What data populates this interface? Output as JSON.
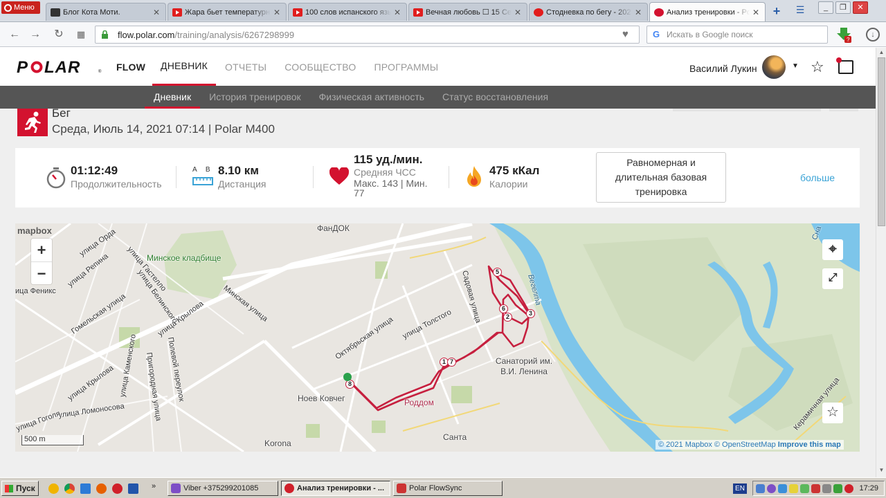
{
  "browser": {
    "menu_label": "Меню",
    "tabs": [
      {
        "title": "Блог Кота Моти.",
        "favicon": "cat-icon"
      },
      {
        "title": "Жара бьет температурн",
        "favicon": "youtube-icon"
      },
      {
        "title": "100 слов испанского язы",
        "favicon": "youtube-icon"
      },
      {
        "title": "Вечная любовь ☐ 15 Се",
        "favicon": "youtube-icon"
      },
      {
        "title": "Стодневка по бегу - 202",
        "favicon": "stop-icon"
      },
      {
        "title": "Анализ тренировки - Po",
        "favicon": "polar-icon"
      }
    ],
    "url_host": "flow.polar.com",
    "url_path": "/training/analysis/6267298999",
    "search_placeholder": "Искать в Google поиск"
  },
  "header": {
    "logo": "POLAR",
    "nav": [
      {
        "label": "FLOW"
      },
      {
        "label": "ДНЕВНИК"
      },
      {
        "label": "ОТЧЕТЫ"
      },
      {
        "label": "СООБЩЕСТВО"
      },
      {
        "label": "ПРОГРАММЫ"
      }
    ],
    "user_name": "Василий Лукин"
  },
  "subnav": [
    {
      "label": "Дневник"
    },
    {
      "label": "История тренировок"
    },
    {
      "label": "Физическая активность"
    },
    {
      "label": "Статус восстановления"
    }
  ],
  "session": {
    "sport": "Бег",
    "subtitle": "Среда, Июль 14, 2021 07:14 | Polar M400"
  },
  "summary": {
    "duration_value": "01:12:49",
    "duration_label": "Продолжительность",
    "distance_ab": "A B",
    "distance_value": "8.10 км",
    "distance_label": "Дистанция",
    "hr_value": "115 уд./мин.",
    "hr_label": "Средняя ЧСС",
    "hr_range": "Макс. 143 | Мин. 77",
    "calories_value": "475 кКал",
    "calories_label": "Калории",
    "training_benefit": "Равномерная и длительная базовая тренировка",
    "more_label": "больше"
  },
  "map": {
    "provider_logo": "mapbox",
    "scale_label": "500 m",
    "attribution_1": "© 2021 Mapbox",
    "attribution_2": "© OpenStreetMap",
    "attribution_3": "Improve this map",
    "zoom_in": "+",
    "zoom_out": "−",
    "labels": [
      {
        "text": "Минское кладбище",
        "kind": "green"
      },
      {
        "text": "ФанДОК",
        "kind": "big"
      },
      {
        "text": "улица Орда"
      },
      {
        "text": "улица Репина"
      },
      {
        "text": "улица Гастелло"
      },
      {
        "text": "улица Белинского"
      },
      {
        "text": "Минская улица"
      },
      {
        "text": "Гомельская улица"
      },
      {
        "text": "улица Крылова"
      },
      {
        "text": "улица Крылова"
      },
      {
        "text": "Полевой переулок"
      },
      {
        "text": "Пригородная улица"
      },
      {
        "text": "улица Каменского"
      },
      {
        "text": "улица Ломоносова"
      },
      {
        "text": "улица Гоголя"
      },
      {
        "text": "Октябрьская улица"
      },
      {
        "text": "улица Толстого"
      },
      {
        "text": "Садовая улица"
      },
      {
        "text": "Санаторий им. В.И. Ленина",
        "kind": "big"
      },
      {
        "text": "Ноев Ковчег",
        "kind": "big"
      },
      {
        "text": "Роддом",
        "kind": "red"
      },
      {
        "text": "Korona",
        "kind": "big"
      },
      {
        "text": "Санта",
        "kind": "big"
      },
      {
        "text": "Керамичная улица"
      },
      {
        "text": "Вегелта",
        "kind": "water"
      },
      {
        "text": "Сна",
        "kind": "water"
      },
      {
        "text": "ица Феникс",
        "kind": "big"
      }
    ],
    "km_markers": [
      "1",
      "2",
      "3",
      "5",
      "6",
      "7",
      "8"
    ]
  },
  "taskbar": {
    "start": "Пуск",
    "items": [
      {
        "label": "Viber +375299201085"
      },
      {
        "label": "Анализ тренировки - ..."
      },
      {
        "label": "Polar FlowSync"
      }
    ],
    "lang": "EN",
    "clock": "17:29"
  },
  "colors": {
    "polar_red": "#d3122f",
    "route": "#c6203f",
    "river": "#7dc5ea",
    "link": "#3aa3d6"
  }
}
